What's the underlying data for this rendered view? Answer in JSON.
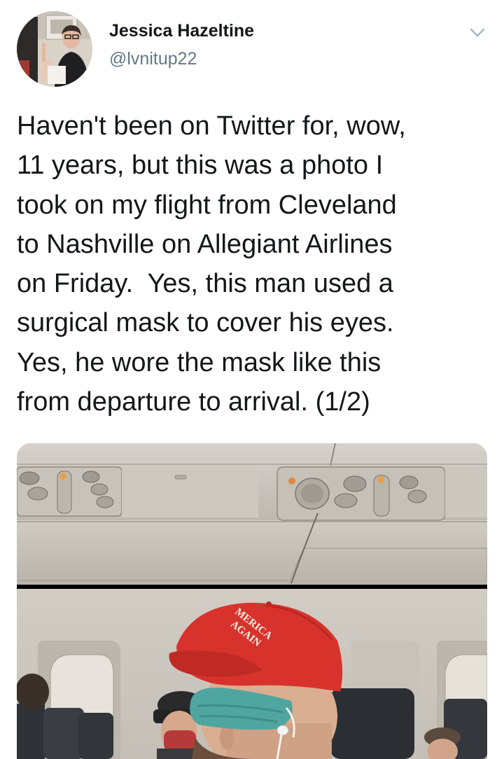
{
  "tweet": {
    "author": {
      "display_name": "Jessica Hazeltine",
      "handle": "@lvnitup22"
    },
    "menu_icon": "chevron-down-icon",
    "text": "Haven't been on Twitter for, wow,\n11 years, but this was a photo I\ntook on my flight from Cleveland\nto Nashville on Allegiant Airlines\non Friday.  Yes, this man used a\nsurgical mask to cover his eyes.\nYes, he wore the mask like this\nfrom departure to arrival. (1/2)",
    "photo": {
      "cap_text_line1": "MERICA",
      "cap_text_line2": "AGAIN"
    }
  },
  "colors": {
    "text_primary": "#14171a",
    "text_secondary": "#657786",
    "cap_red": "#d8322c",
    "mask_teal": "#4fa6a0"
  }
}
